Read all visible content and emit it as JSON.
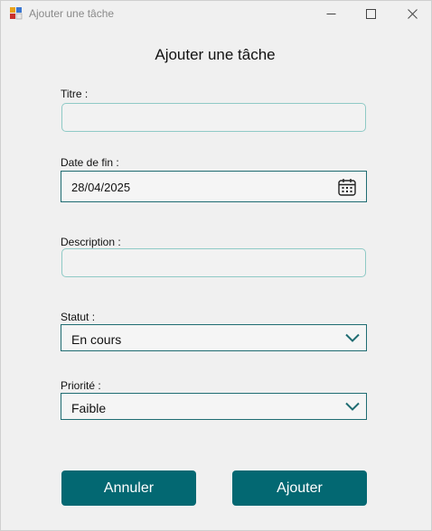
{
  "window": {
    "title": "Ajouter une tâche"
  },
  "form": {
    "heading": "Ajouter une tâche",
    "titre_label": "Titre :",
    "titre_value": "",
    "date_label": "Date de fin :",
    "date_value": "28/04/2025",
    "description_label": "Description :",
    "description_value": "",
    "statut_label": "Statut :",
    "statut_value": "En cours",
    "priorite_label": "Priorité :",
    "priorite_value": "Faible"
  },
  "buttons": {
    "cancel_label": "Annuler",
    "add_label": "Ajouter"
  },
  "colors": {
    "accent": "#036872",
    "border": "#1f6c72",
    "textbox_border": "#8fcac6",
    "background": "#f0f0f0"
  },
  "icons": {
    "app": "app-icon",
    "minimize": "minimize-icon",
    "maximize": "maximize-icon",
    "close": "close-icon",
    "calendar": "calendar-icon",
    "dropdown": "chevron-down-icon"
  }
}
